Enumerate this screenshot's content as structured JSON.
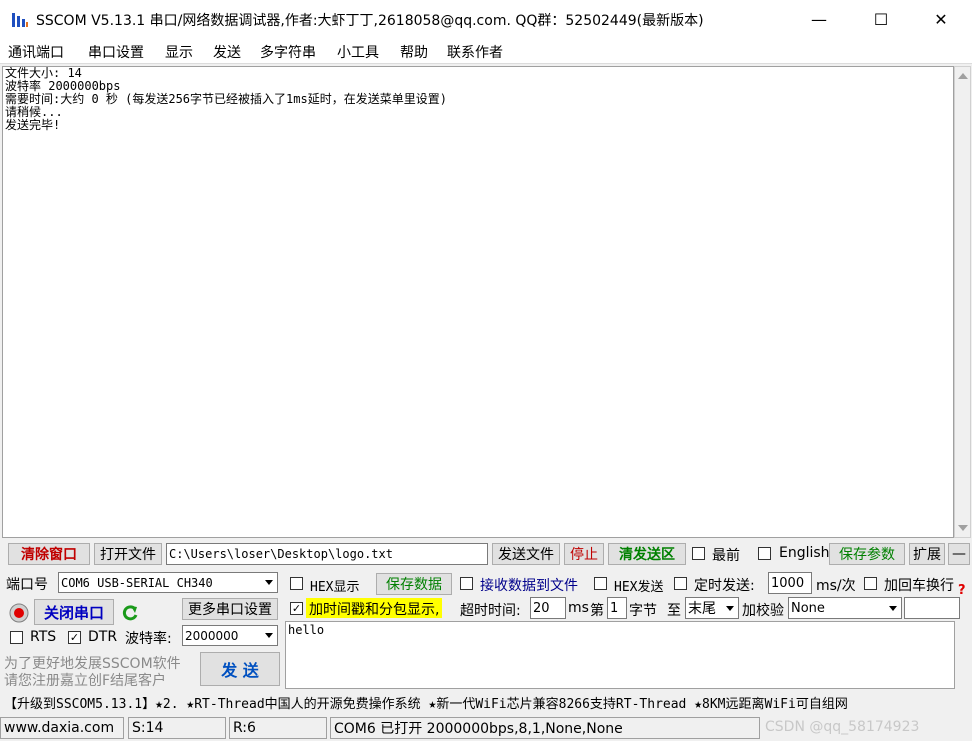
{
  "window": {
    "title": "SSCOM V5.13.1 串口/网络数据调试器,作者:大虾丁丁,2618058@qq.com. QQ群：52502449(最新版本)",
    "minimize": "—",
    "maximize": "☐",
    "close": "✕"
  },
  "menu": [
    "通讯端口",
    "串口设置",
    "显示",
    "发送",
    "多字符串",
    "小工具",
    "帮助",
    "联系作者"
  ],
  "receive": {
    "lines": [
      "文件大小: 14",
      "波特率 2000000bps",
      "需要时间:大约 0 秒 (每发送256字节已经被插入了1ms延时，在发送菜单里设置)",
      "请稍候...",
      "发送完毕!"
    ]
  },
  "toolbar": {
    "clear_window": "清除窗口",
    "open_file": "打开文件",
    "file_path": "C:\\Users\\loser\\Desktop\\logo.txt",
    "send_file": "发送文件",
    "stop": "停止",
    "clear_send": "清发送区",
    "topmost": "最前",
    "english": "English",
    "save_params": "保存参数",
    "expand": "扩展",
    "collapse": "—"
  },
  "port": {
    "port_label": "端口号",
    "port_value": "COM6 USB-SERIAL CH340",
    "close_port": "关闭串口",
    "more_settings": "更多串口设置",
    "rts": "RTS",
    "dtr": "DTR",
    "baud_label": "波特率:",
    "baud_value": "2000000",
    "hint_line1": "为了更好地发展SSCOM软件",
    "hint_line2": "请您注册嘉立创F结尾客户",
    "send": "发  送"
  },
  "options": {
    "hex_display": "HEX显示",
    "save_data": "保存数据",
    "recv_to_file": "接收数据到文件",
    "hex_send": "HEX发送",
    "timed_send": "定时发送:",
    "interval": "1000",
    "interval_unit": "ms/次",
    "add_crlf": "加回车换行",
    "timestamp": "加时间戳和分包显示,",
    "timeout_label": "超时时间:",
    "timeout_value": "20",
    "timeout_unit": "ms",
    "byte_prefix": "第",
    "byte_index": "1",
    "byte_suffix": "字节",
    "to_label": "至",
    "to_value": "末尾",
    "checksum_label": "加校验",
    "checksum_value": "None",
    "help_mark": "?"
  },
  "send_area": {
    "text": "hello"
  },
  "marquee": "【升级到SSCOM5.13.1】★2. ★RT-Thread中国人的开源免费操作系统 ★新一代WiFi芯片兼容8266支持RT-Thread ★8KM远距离WiFi可自组网",
  "status": {
    "site": "www.daxia.com",
    "sent": "S:14",
    "recv": "R:6",
    "port_info": "COM6 已打开  2000000bps,8,1,None,None",
    "watermark": "CSDN @qq_58174923"
  },
  "colors": {
    "accent_red": "#c00000",
    "accent_green": "#008000",
    "highlight_yellow": "#ffff00"
  }
}
